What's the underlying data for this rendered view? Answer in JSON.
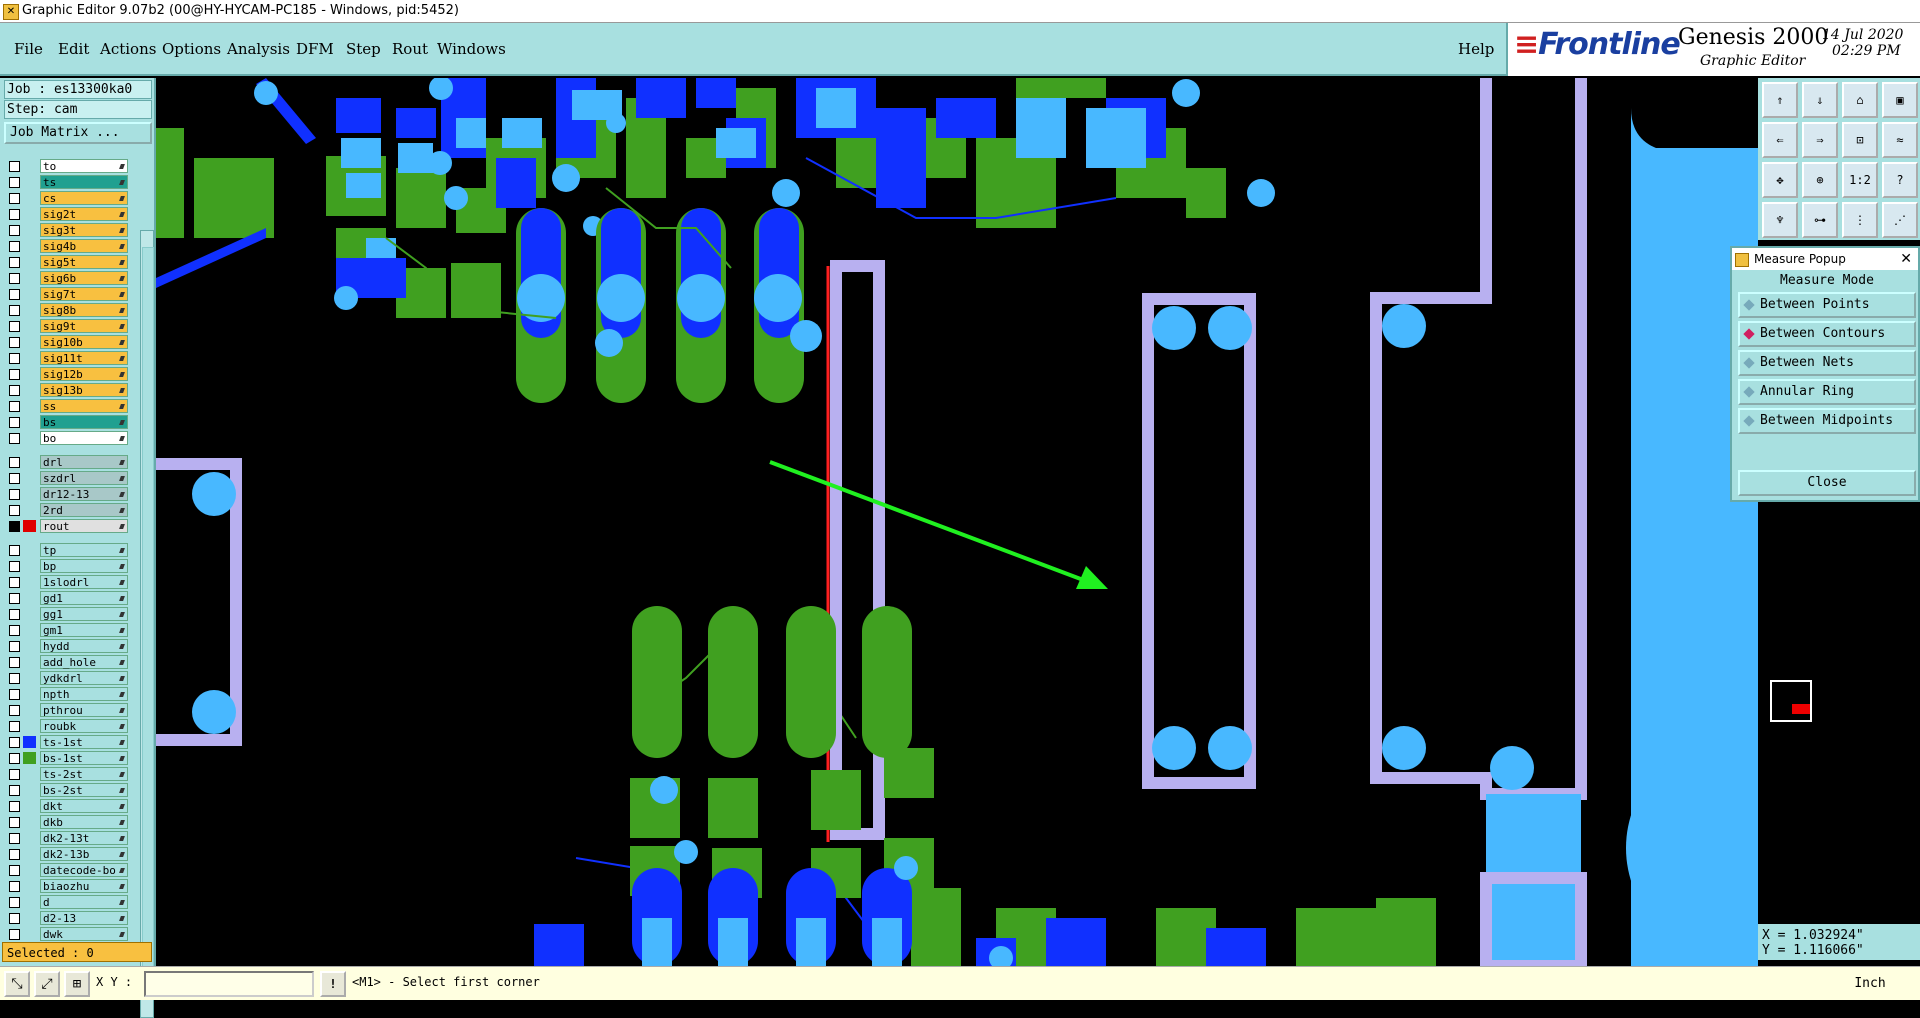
{
  "window": {
    "title": "Graphic Editor 9.07b2 (00@HY-HYCAM-PC185 - Windows, pid:5452)"
  },
  "menu": {
    "items": [
      "File",
      "Edit",
      "Actions",
      "Options",
      "Analysis",
      "DFM",
      "Step",
      "Rout",
      "Windows"
    ],
    "help": "Help"
  },
  "brand": {
    "logo": "Frontline",
    "product": "Genesis 2000",
    "subtitle": "Graphic Editor",
    "date": "14 Jul 2020",
    "time": "02:29 PM"
  },
  "job": {
    "job_line": "Job : es13300ka0",
    "step_line": "Step: cam",
    "matrix_button": "Job Matrix ..."
  },
  "layers_group1": [
    {
      "name": "to",
      "color": "#ffffff",
      "checked": false
    },
    {
      "name": "ts",
      "color": "#20a090",
      "checked": false
    },
    {
      "name": "cs",
      "color": "#f8c040",
      "checked": false
    },
    {
      "name": "sig2t",
      "color": "#f8c040",
      "checked": false
    },
    {
      "name": "sig3t",
      "color": "#f8c040",
      "checked": false
    },
    {
      "name": "sig4b",
      "color": "#f8c040",
      "checked": false
    },
    {
      "name": "sig5t",
      "color": "#f8c040",
      "checked": false
    },
    {
      "name": "sig6b",
      "color": "#f8c040",
      "checked": false
    },
    {
      "name": "sig7t",
      "color": "#f8c040",
      "checked": false
    },
    {
      "name": "sig8b",
      "color": "#f8c040",
      "checked": false
    },
    {
      "name": "sig9t",
      "color": "#f8c040",
      "checked": false
    },
    {
      "name": "sig10b",
      "color": "#f8c040",
      "checked": false
    },
    {
      "name": "sig11t",
      "color": "#f8c040",
      "checked": false
    },
    {
      "name": "sig12b",
      "color": "#f8c040",
      "checked": false
    },
    {
      "name": "sig13b",
      "color": "#f8c040",
      "checked": false
    },
    {
      "name": "ss",
      "color": "#f8c040",
      "checked": false
    },
    {
      "name": "bs",
      "color": "#20a090",
      "checked": false
    },
    {
      "name": "bo",
      "color": "#ffffff",
      "checked": false
    }
  ],
  "layers_group2": [
    {
      "name": "drl",
      "color": "#a8c8c8",
      "checked": false
    },
    {
      "name": "szdrl",
      "color": "#a8c8c8",
      "checked": false
    },
    {
      "name": "dr12-13",
      "color": "#a8c8c8",
      "checked": false
    },
    {
      "name": "2rd",
      "color": "#a8c8c8",
      "checked": false
    },
    {
      "name": "rout",
      "color": "#e0e0e0",
      "checked": true,
      "swatch": "#e00000"
    }
  ],
  "layers_group3": [
    {
      "name": "tp",
      "color": "#a8e0e0",
      "checked": false
    },
    {
      "name": "bp",
      "color": "#a8e0e0",
      "checked": false
    },
    {
      "name": "1slodrl",
      "color": "#a8e0e0",
      "checked": false
    },
    {
      "name": "gd1",
      "color": "#a8e0e0",
      "checked": false
    },
    {
      "name": "gg1",
      "color": "#a8e0e0",
      "checked": false
    },
    {
      "name": "gm1",
      "color": "#a8e0e0",
      "checked": false
    },
    {
      "name": "hydd",
      "color": "#a8e0e0",
      "checked": false
    },
    {
      "name": "add_hole",
      "color": "#a8e0e0",
      "checked": false
    },
    {
      "name": "ydkdrl",
      "color": "#a8e0e0",
      "checked": false
    },
    {
      "name": "npth",
      "color": "#a8e0e0",
      "checked": false
    },
    {
      "name": "pthrou",
      "color": "#a8e0e0",
      "checked": false
    },
    {
      "name": "roubk",
      "color": "#a8e0e0",
      "checked": false
    },
    {
      "name": "ts-1st",
      "color": "#a8e0e0",
      "checked": false,
      "swatch": "#1030ff"
    },
    {
      "name": "bs-1st",
      "color": "#a8e0e0",
      "checked": false,
      "swatch": "#40a020"
    },
    {
      "name": "ts-2st",
      "color": "#a8e0e0",
      "checked": false
    },
    {
      "name": "bs-2st",
      "color": "#a8e0e0",
      "checked": false
    },
    {
      "name": "dkt",
      "color": "#a8e0e0",
      "checked": false
    },
    {
      "name": "dkb",
      "color": "#a8e0e0",
      "checked": false
    },
    {
      "name": "dk2-13t",
      "color": "#a8e0e0",
      "checked": false
    },
    {
      "name": "dk2-13b",
      "color": "#a8e0e0",
      "checked": false
    },
    {
      "name": "datecode-bo",
      "color": "#a8e0e0",
      "checked": false
    },
    {
      "name": "biaozhu",
      "color": "#a8e0e0",
      "checked": false
    },
    {
      "name": "d",
      "color": "#a8e0e0",
      "checked": false
    },
    {
      "name": "d2-13",
      "color": "#a8e0e0",
      "checked": false
    },
    {
      "name": "dwk",
      "color": "#a8e0e0",
      "checked": false
    }
  ],
  "selected": "Selected : 0",
  "measure": {
    "title": "Measure Popup",
    "mode_label": "Measure Mode",
    "options": [
      {
        "label": "Between Points",
        "active": false
      },
      {
        "label": "Between Contours",
        "active": true
      },
      {
        "label": "Between Nets",
        "active": false
      },
      {
        "label": "Annular Ring",
        "active": false
      },
      {
        "label": "Between Midpoints",
        "active": false
      }
    ],
    "close": "Close"
  },
  "tools": {
    "tool_11": "1:2",
    "tool_12": "?"
  },
  "coords": {
    "x": "X = 1.032924\"",
    "y": "Y = 1.116066\""
  },
  "status": {
    "xy_label": "X Y :",
    "message": "<M1> - Select first corner",
    "units": "Inch"
  },
  "colors": {
    "panel": "#a8e0e0",
    "green_pad": "#40a020",
    "blue_pad": "#1030ff",
    "light_blue": "#48b8ff",
    "lavender": "#b8b0f0",
    "arrow": "#20f020"
  }
}
